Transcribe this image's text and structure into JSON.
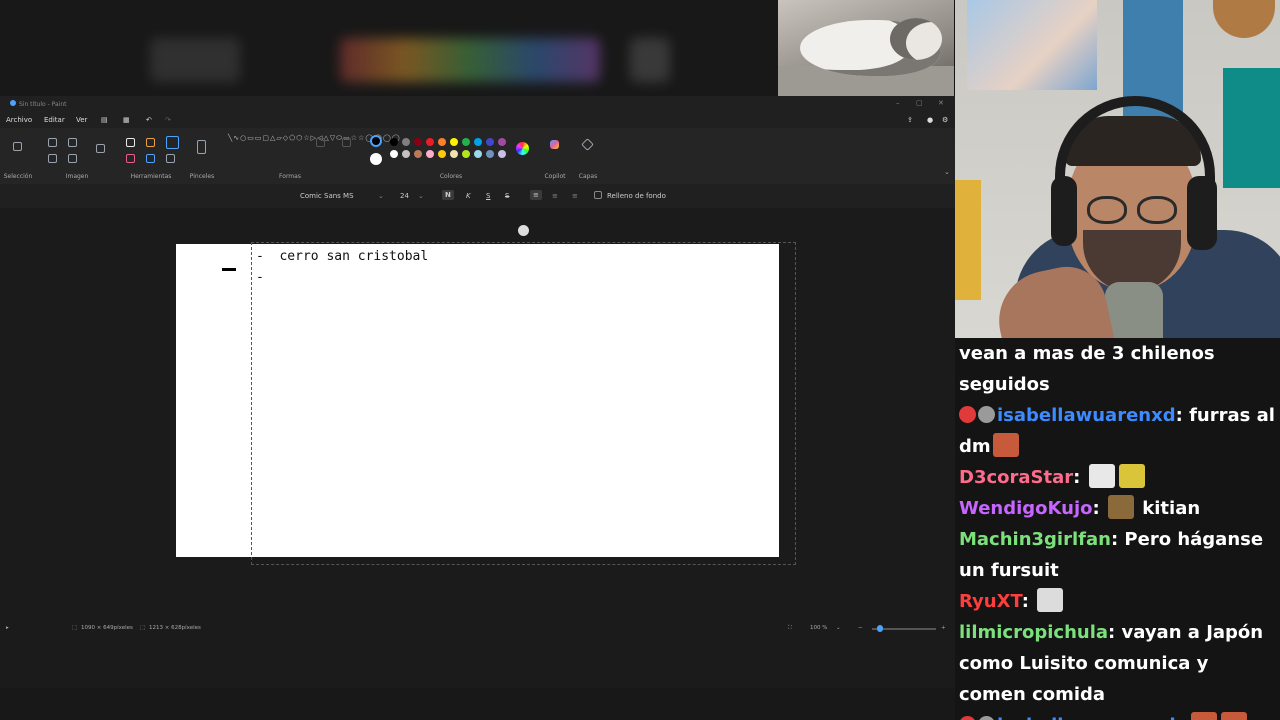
{
  "paint": {
    "title": "Sin título - Paint",
    "menu": [
      "Archivo",
      "Editar",
      "Ver"
    ],
    "groups": [
      "Selección",
      "Imagen",
      "Herramientas",
      "Pinceles",
      "Formas",
      "Colores",
      "Copilot",
      "Capas"
    ],
    "font_name": "Comic Sans MS",
    "font_size": "24",
    "bold": "N",
    "italic": "K",
    "underline": "S",
    "strike": "S",
    "fill_bg_label": "Relleno de fondo",
    "canvas_lines": [
      "-  cerro san cristobal",
      "-"
    ],
    "status_canvas": "1090 × 649píxeles",
    "status_selection": "1213 × 628píxeles",
    "zoom": "100 %",
    "palette": [
      "#000000",
      "#7f7f7f",
      "#880015",
      "#ed1c24",
      "#ff7f27",
      "#fff200",
      "#22b14c",
      "#00a2e8",
      "#3f48cc",
      "#a349a4",
      "#ffffff",
      "#c3c3c3",
      "#b97a57",
      "#ffaec9",
      "#ffc90e",
      "#efe4b0",
      "#b5e61d",
      "#99d9ea",
      "#7092be",
      "#c8bfe7"
    ],
    "primary_color": "#000000",
    "secondary_color": "#ffffff"
  },
  "chat": {
    "messages": [
      {
        "user": "",
        "text": "vean a mas de 3 chilenos seguidos",
        "color": "#ffffff"
      },
      {
        "user": "isabellawuarenxd",
        "text": "furras al dm",
        "color": "#3d8bff",
        "badges": true,
        "emote_end": true
      },
      {
        "user": "D3coraStar",
        "text": "",
        "color": "#ff6b8a",
        "emotes": 2
      },
      {
        "user": "WendigoKujo",
        "text": "kitian",
        "color": "#c665ff",
        "emotes": 1
      },
      {
        "user": "Machin3girlfan",
        "text": "Pero háganse un fursuit",
        "color": "#7ce07c"
      },
      {
        "user": "RyuXT",
        "text": "",
        "color": "#ff3d3d",
        "emotes": 1
      },
      {
        "user": "lilmicropichula",
        "text": "vayan a Japón como Luisito comunica y comen comida",
        "color": "#7ce07c"
      },
      {
        "user": "isabellawuarenxd",
        "text": "",
        "color": "#3d8bff",
        "badges": true,
        "emotes": 2
      }
    ]
  }
}
